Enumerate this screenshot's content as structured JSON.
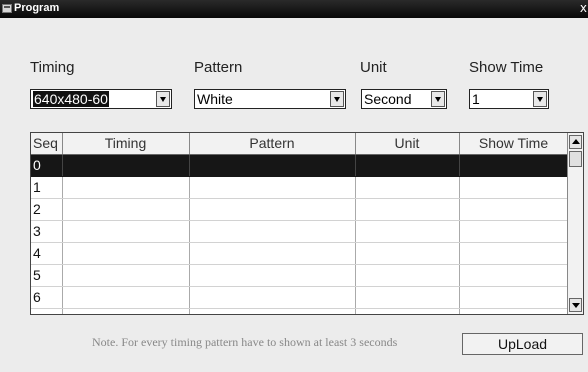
{
  "window": {
    "title": "Program",
    "close_glyph": "x"
  },
  "controls": {
    "timing": {
      "label": "Timing",
      "value": "640x480-60"
    },
    "pattern": {
      "label": "Pattern",
      "value": "White"
    },
    "unit": {
      "label": "Unit",
      "value": "Second"
    },
    "show_time": {
      "label": "Show Time",
      "value": "1"
    }
  },
  "table": {
    "columns": [
      "Seq",
      "Timing",
      "Pattern",
      "Unit",
      "Show Time"
    ],
    "rows": [
      {
        "seq": "0",
        "timing": "",
        "pattern": "",
        "unit": "",
        "show_time": ""
      },
      {
        "seq": "1",
        "timing": "",
        "pattern": "",
        "unit": "",
        "show_time": ""
      },
      {
        "seq": "2",
        "timing": "",
        "pattern": "",
        "unit": "",
        "show_time": ""
      },
      {
        "seq": "3",
        "timing": "",
        "pattern": "",
        "unit": "",
        "show_time": ""
      },
      {
        "seq": "4",
        "timing": "",
        "pattern": "",
        "unit": "",
        "show_time": ""
      },
      {
        "seq": "5",
        "timing": "",
        "pattern": "",
        "unit": "",
        "show_time": ""
      },
      {
        "seq": "6",
        "timing": "",
        "pattern": "",
        "unit": "",
        "show_time": ""
      },
      {
        "seq": "",
        "timing": "",
        "pattern": "",
        "unit": "",
        "show_time": ""
      }
    ],
    "selected_row": 0
  },
  "footer": {
    "note": "Note. For every timing pattern have to shown at least 3 seconds",
    "upload_label": "UpLoad"
  },
  "icons": {
    "app": "program-window-icon",
    "close": "close-icon",
    "dropdown": "chevron-down-icon",
    "scroll_up": "scroll-up-arrow-icon",
    "scroll_down": "scroll-down-arrow-icon"
  },
  "colors": {
    "titlebar": "#111111",
    "selection": "#161616",
    "dialog_bg": "#ececec"
  }
}
